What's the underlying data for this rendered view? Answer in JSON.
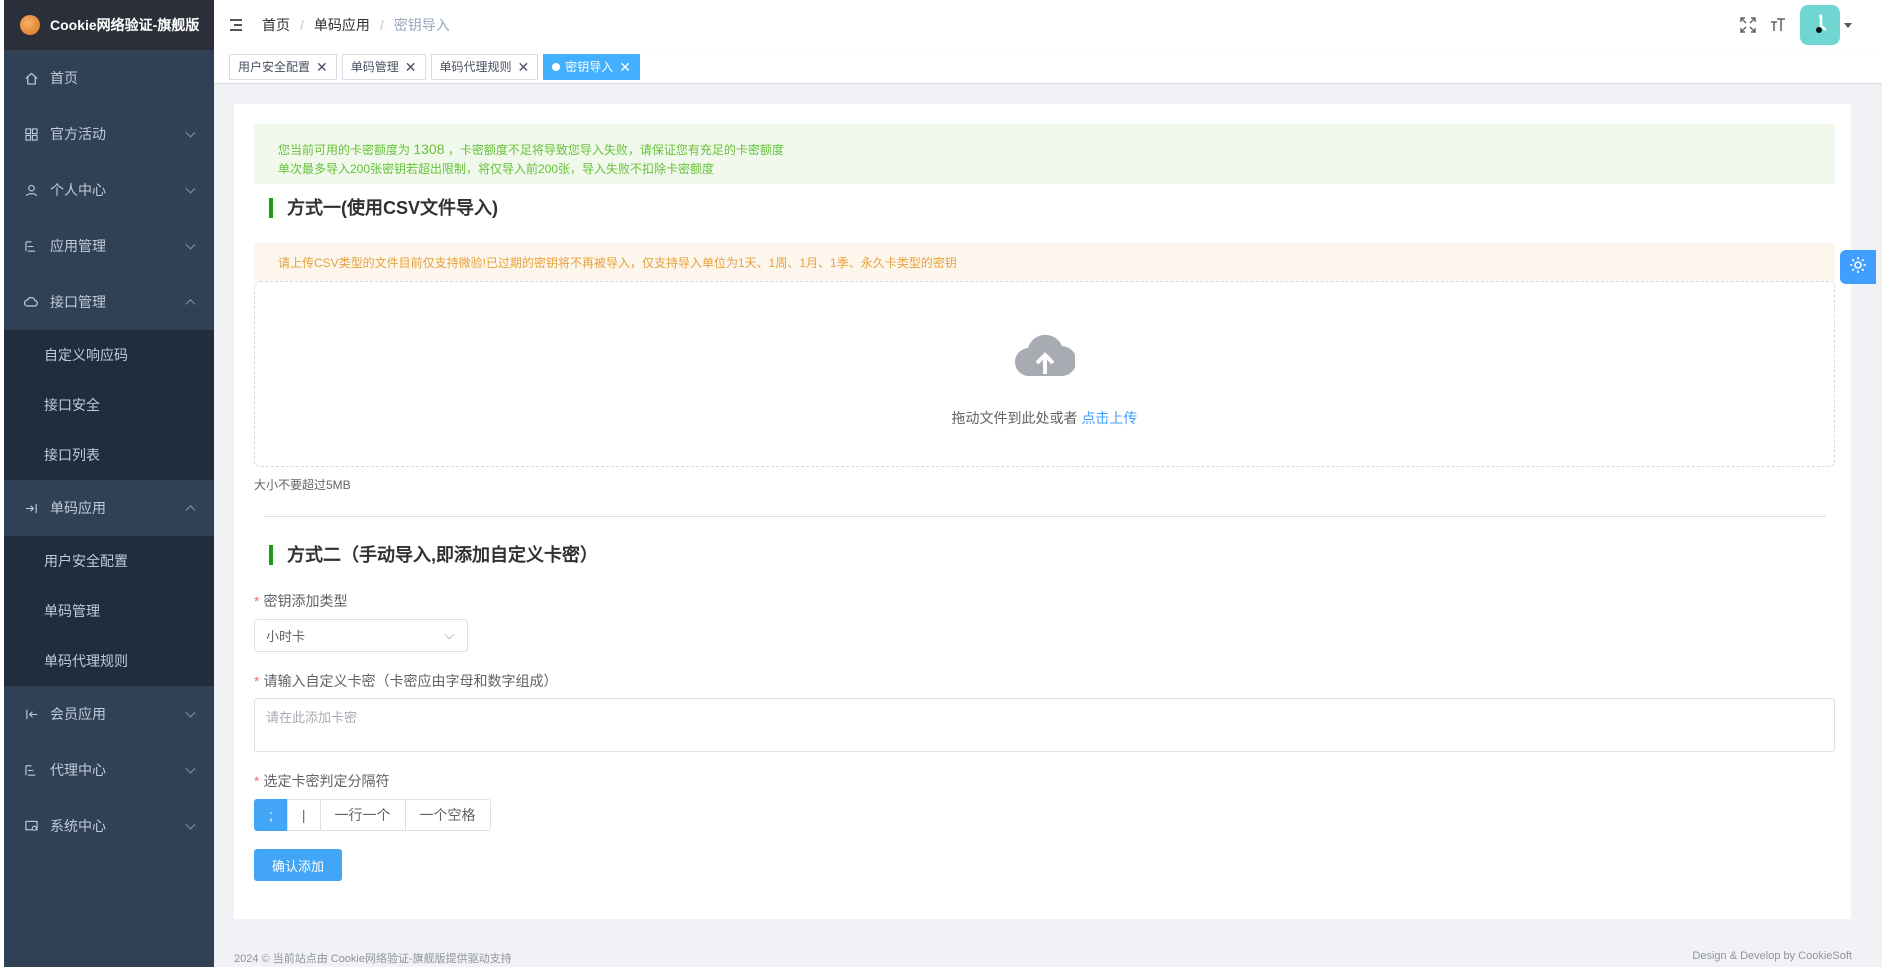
{
  "app": {
    "title": "Cookie网络验证-旗舰版"
  },
  "sidebar": {
    "items": [
      {
        "label": "首页",
        "icon": "home-icon"
      },
      {
        "label": "官方活动",
        "icon": "apps-icon"
      },
      {
        "label": "个人中心",
        "icon": "user-icon"
      },
      {
        "label": "应用管理",
        "icon": "list-icon"
      },
      {
        "label": "接口管理",
        "icon": "cloud-icon",
        "expanded": true,
        "children": [
          "自定义响应码",
          "接口安全",
          "接口列表"
        ]
      },
      {
        "label": "单码应用",
        "icon": "login-icon",
        "expanded": true,
        "children": [
          "用户安全配置",
          "单码管理",
          "单码代理规则"
        ]
      },
      {
        "label": "会员应用",
        "icon": "logout-icon"
      },
      {
        "label": "代理中心",
        "icon": "list-icon"
      },
      {
        "label": "系统中心",
        "icon": "monitor-icon"
      }
    ]
  },
  "breadcrumb": [
    "首页",
    "单码应用",
    "密钥导入"
  ],
  "tags": [
    "用户安全配置",
    "单码管理",
    "单码代理规则",
    "密钥导入"
  ],
  "notice": {
    "prefix": "您当前可用的卡密额度为 ",
    "quota": "1308",
    "suffix": " ，卡密额度不足将导致您导入失败，请保证您有充足的卡密额度",
    "line2": "单次最多导入200张密钥若超出限制，将仅导入前200张，导入失败不扣除卡密额度"
  },
  "method1": {
    "title": "方式一(使用CSV文件导入)",
    "warning": "请上传CSV类型的文件目前仅支持微验!已过期的密钥将不再被导入，仅支持导入单位为1天、1周、1月、1季、永久卡类型的密钥",
    "upload_text": "拖动文件到此处或者 ",
    "upload_link": "点击上传",
    "tip": "大小不要超过5MB"
  },
  "method2": {
    "title": "方式二（手动导入,即添加自定义卡密）",
    "type_label": "密钥添加类型",
    "type_value": "小时卡",
    "key_label": "请输入自定义卡密（卡密应由字母和数字组成）",
    "key_placeholder": "请在此添加卡密",
    "sep_label": "选定卡密判定分隔符",
    "separators": [
      ";",
      "|",
      "一行一个",
      "一个空格"
    ],
    "submit": "确认添加"
  },
  "footer": {
    "left": "2024 © 当前站点由 Cookie网络验证-旗舰版提供驱动支持",
    "right": "Design & Develop by CookieSoft"
  },
  "colors": {
    "sidebar": "#304156",
    "primary": "#42a5f5",
    "green_bar": "#1a9c1a"
  }
}
